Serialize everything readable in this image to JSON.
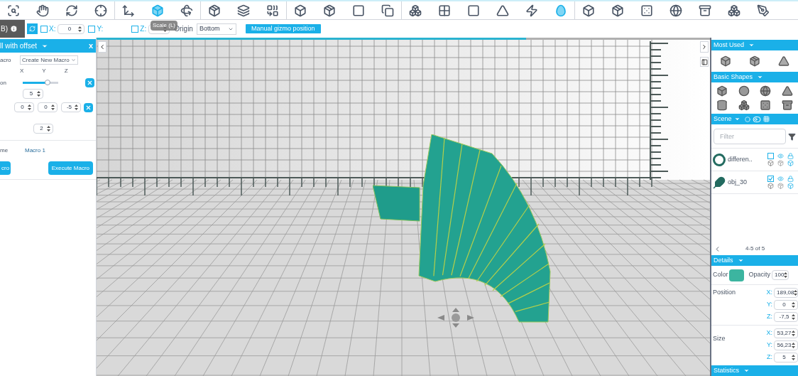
{
  "toolbar": {
    "groups": [
      {
        "tools": [
          {
            "selected": false
          },
          {
            "selected": false
          },
          {
            "selected": false
          },
          {
            "selected": false
          }
        ]
      },
      {
        "tools": [
          {
            "selected": false
          },
          {
            "selected": true
          },
          {
            "selected": false
          }
        ]
      },
      {
        "tools": [
          {
            "selected": false
          },
          {
            "selected": false
          },
          {
            "selected": false
          }
        ]
      },
      {
        "tools": [
          {
            "selected": false
          },
          {
            "selected": false
          },
          {
            "selected": false
          },
          {
            "selected": false
          }
        ]
      },
      {
        "tools": [
          {
            "selected": false
          },
          {
            "selected": false
          },
          {
            "selected": false
          },
          {
            "selected": false
          },
          {
            "selected": false
          },
          {
            "selected": true
          }
        ]
      },
      {
        "tools": [
          {
            "selected": false
          },
          {
            "selected": false
          },
          {
            "selected": false
          },
          {
            "selected": false
          },
          {
            "selected": false
          },
          {
            "selected": false
          },
          {
            "selected": false
          }
        ]
      }
    ]
  },
  "tooltip": "Scale (L)",
  "gizmo_bar": {
    "left_label": "B)",
    "sync_on": true,
    "x": {
      "label": "X:",
      "checked": false,
      "value": "0"
    },
    "y": {
      "label": "Y:",
      "checked": false
    },
    "z": {
      "label": "Z:",
      "checked": false
    },
    "origin_label": "Origin",
    "origin_value": "Bottom",
    "manual_button": "Manual gizmo position"
  },
  "loading": {
    "level": 0.7
  },
  "macro_panel": {
    "title": "ll with offset",
    "close": "x",
    "macro_label": "acro",
    "macro_select": "Create New Macro",
    "axis_headers": [
      "X",
      "Y",
      "Z"
    ],
    "rotation_label": "on",
    "slider": {
      "level": 0.7
    },
    "count": "5",
    "offsets": [
      "0",
      "0",
      "-5"
    ],
    "repeat": "2",
    "name_label": "me",
    "name_value": "Macro 1",
    "buttons": [
      "cro",
      "Execute Macro"
    ]
  },
  "most_used": {
    "title": "Most Used"
  },
  "basic_shapes": {
    "title": "Basic Shapes"
  },
  "scene": {
    "title": "Scene",
    "filter_placeholder": "Filter",
    "objects": [
      {
        "name": "differen..",
        "checked": false
      },
      {
        "name": "obj_30",
        "checked": true
      }
    ],
    "pagination": "4-5 of 5"
  },
  "details": {
    "title": "Details",
    "color_label": "Color",
    "color": "#3cb5a0",
    "opacity_label": "Opacity",
    "opacity": "100",
    "position_label": "Position",
    "position": [
      {
        "axis": "X:",
        "value": "189,08"
      },
      {
        "axis": "Y:",
        "value": "0"
      },
      {
        "axis": "Z:",
        "value": "-7,5"
      }
    ],
    "size_label": "Size",
    "size": [
      {
        "axis": "X:",
        "value": "53,27"
      },
      {
        "axis": "Y:",
        "value": "56,23"
      },
      {
        "axis": "Z:",
        "value": "5"
      }
    ]
  },
  "statistics": {
    "title": "Statistics"
  }
}
